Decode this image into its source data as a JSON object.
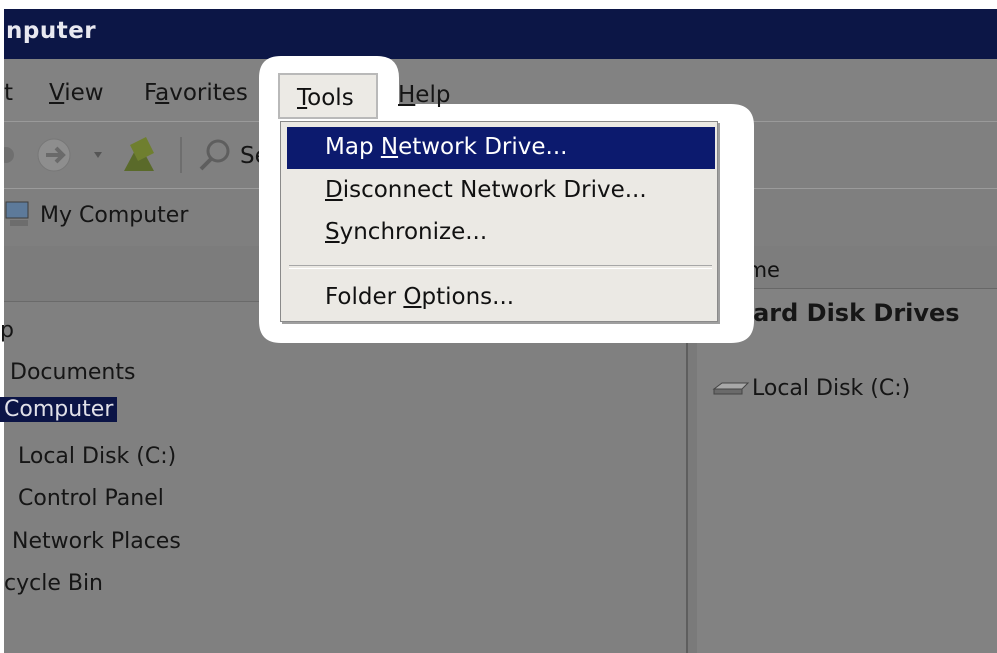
{
  "window": {
    "title": "nputer"
  },
  "menubar": {
    "items": [
      {
        "label": "t"
      },
      {
        "label": "View",
        "accel_index": 0
      },
      {
        "label": "Favorites",
        "accel_index": 1
      },
      {
        "label": "Tools",
        "accel_index": 0
      },
      {
        "label": "Help",
        "accel_index": 0
      }
    ]
  },
  "toolbar": {
    "search_label": "Se"
  },
  "address": {
    "value": "My Computer"
  },
  "tools_menu": {
    "items": [
      {
        "label": "Map Network Drive...",
        "pre": "Map ",
        "accel": "N",
        "post": "etwork Drive..."
      },
      {
        "label": "Disconnect Network Drive...",
        "pre": "",
        "accel": "D",
        "post": "isconnect Network Drive..."
      },
      {
        "label": "Synchronize...",
        "pre": "",
        "accel": "S",
        "post": "ynchronize..."
      },
      {
        "label": "Folder Options...",
        "pre": "Folder ",
        "accel": "O",
        "post": "ptions..."
      }
    ],
    "highlighted_index": 0
  },
  "tree": {
    "items": [
      {
        "label": "p"
      },
      {
        "label": "Documents"
      },
      {
        "label": "Computer",
        "selected": true
      },
      {
        "label": "Local Disk (C:)"
      },
      {
        "label": "Control Panel"
      },
      {
        "label": "Network Places"
      },
      {
        "label": "cycle Bin"
      }
    ]
  },
  "details": {
    "column_name": "Name",
    "group_heading": "Hard Disk Drives",
    "items": [
      {
        "label": "Local Disk (C:)"
      }
    ]
  },
  "colors": {
    "titlebar": "#0c1646",
    "menu_highlight": "#0c1a6e",
    "dim_background": "#808080",
    "menu_background": "#ebe9e4"
  }
}
